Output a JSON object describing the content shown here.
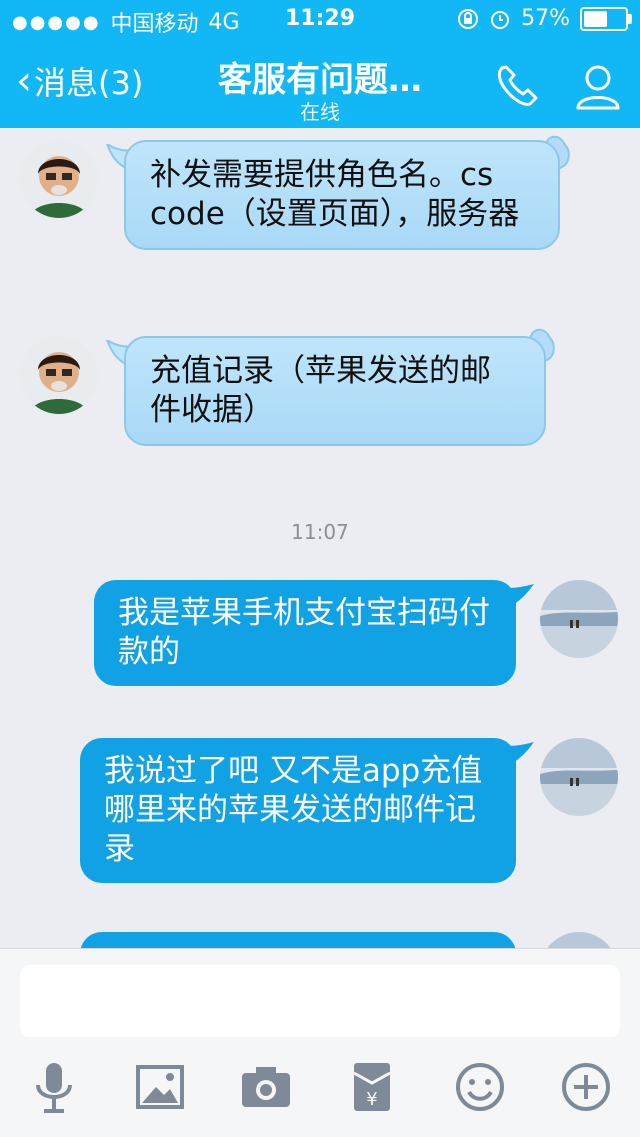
{
  "status_bar": {
    "signal_dots": "●●●●●",
    "carrier": "中国移动",
    "network": "4G",
    "time": "11:29",
    "battery_text": "57%",
    "battery_level": 0.57
  },
  "nav": {
    "back_label": "消息(3)",
    "title": "客服有问题…",
    "subtitle": "在线"
  },
  "messages": [
    {
      "side": "in",
      "text": "补发需要提供角色名。cs code（设置页面），服务器"
    },
    {
      "side": "in",
      "text": "充值记录（苹果发送的邮件收据）"
    },
    {
      "side": "out",
      "text": "我是苹果手机支付宝扫码付款的"
    },
    {
      "side": "out",
      "text": "我说过了吧 又不是app充值 哪里来的苹果发送的邮件记录"
    }
  ],
  "timestamp": "11:07",
  "input": {
    "placeholder": ""
  },
  "toolbar": [
    "microphone-icon",
    "image-icon",
    "camera-icon",
    "red-packet-icon",
    "emoji-icon",
    "plus-icon"
  ],
  "colors": {
    "header": "#12b7f5",
    "out_bubble": "#10a2e5",
    "in_bubble": "#b6dff9",
    "background": "#ebedf2"
  }
}
